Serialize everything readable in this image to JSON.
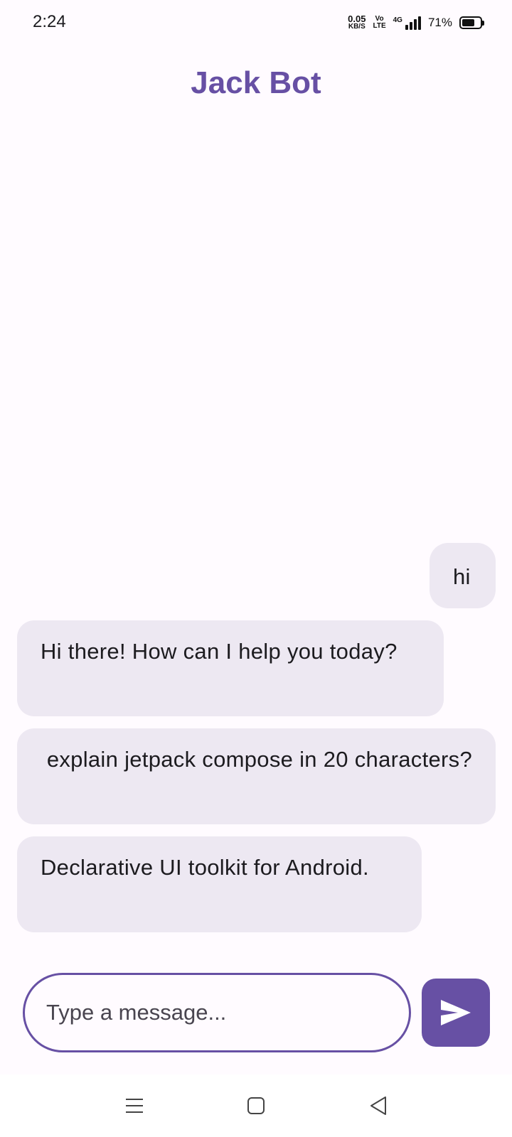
{
  "status_bar": {
    "time": "2:24",
    "net_speed": "0.05",
    "net_speed_unit": "KB/S",
    "volte_top": "Vo",
    "volte_bottom": "LTE",
    "network_type": "4G",
    "battery_percent": "71%",
    "battery_level": 0.71
  },
  "header": {
    "title": "Jack Bot"
  },
  "chat": {
    "messages": [
      {
        "sender": "user",
        "text": "hi"
      },
      {
        "sender": "bot",
        "text": "Hi there! How can I help you today?"
      },
      {
        "sender": "user",
        "text": "explain jetpack compose in 20 characters?"
      },
      {
        "sender": "bot",
        "text": "Declarative UI toolkit for Android."
      }
    ]
  },
  "composer": {
    "placeholder": "Type a message...",
    "value": "",
    "send_icon": "send-icon"
  },
  "colors": {
    "accent": "#6750a4",
    "bubble": "#ede8f2",
    "background": "#fffbff"
  },
  "nav_bar": {
    "icons": [
      "menu-icon",
      "home-icon",
      "back-icon"
    ]
  }
}
